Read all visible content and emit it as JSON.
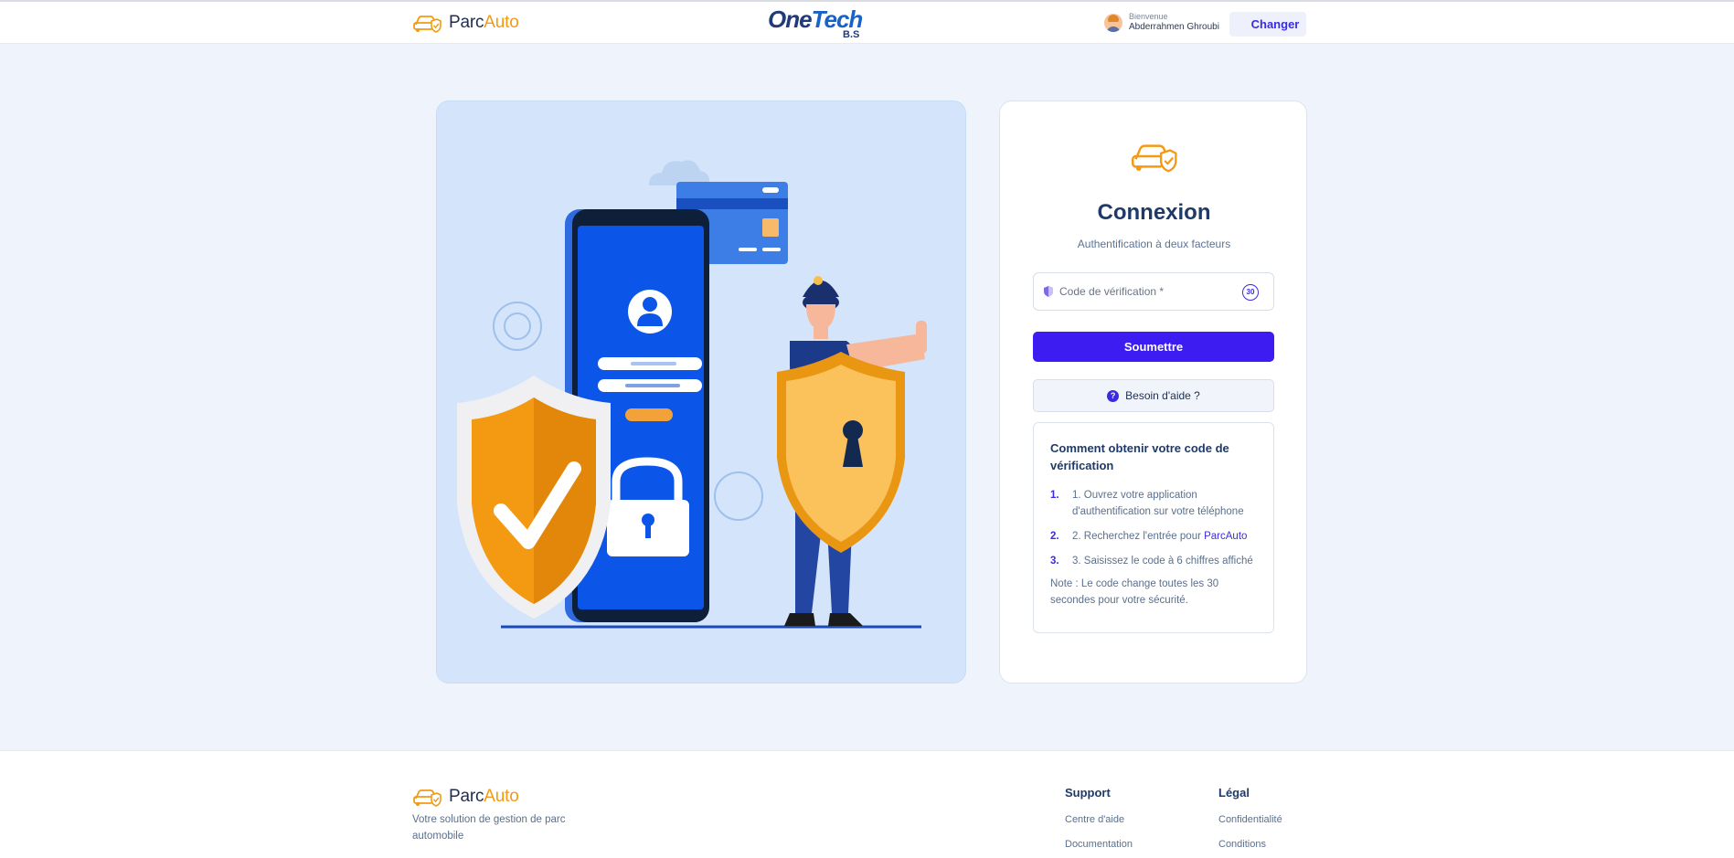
{
  "header": {
    "brand": {
      "name_prefix": "Parc",
      "name_accent": "Auto"
    },
    "partner_logo": {
      "name_prefix": "One",
      "name_accent": "Tech",
      "suffix": "B.S"
    },
    "user": {
      "greeting": "Bienvenue",
      "name": "Abderrahmen Ghroubi"
    },
    "change_label": "Changer"
  },
  "login": {
    "title": "Connexion",
    "subtitle": "Authentification à deux facteurs",
    "code_field": {
      "placeholder": "Code de vérification *",
      "timer": "30"
    },
    "submit_label": "Soumettre",
    "help_label": "Besoin d'aide ?",
    "instructions": {
      "title": "Comment obtenir votre code de vérification",
      "steps": [
        {
          "num": "1.",
          "text": "1. Ouvrez votre application d'authentification sur votre téléphone"
        },
        {
          "num": "2.",
          "text": "2. Recherchez l'entrée pour ",
          "highlight": "ParcAuto"
        },
        {
          "num": "3.",
          "text": "3. Saisissez le code à 6 chiffres affiché"
        }
      ],
      "note": "Note : Le code change toutes les 30 secondes pour votre sécurité."
    }
  },
  "footer": {
    "brand": {
      "name_prefix": "Parc",
      "name_accent": "Auto"
    },
    "tagline": "Votre solution de gestion de parc automobile",
    "support": {
      "title": "Support",
      "links": [
        "Centre d'aide",
        "Documentation"
      ]
    },
    "legal": {
      "title": "Légal",
      "links": [
        "Confidentialité",
        "Conditions"
      ]
    }
  },
  "colors": {
    "primary": "#3c1cf0",
    "accent": "#f39a12",
    "navy": "#1f3a67",
    "background": "#eff4fc"
  }
}
